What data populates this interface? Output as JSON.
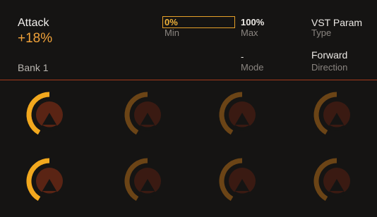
{
  "param": {
    "name": "Attack",
    "value": "+18%",
    "bank": "Bank 1"
  },
  "fields": {
    "min": {
      "value": "0%",
      "label": "Min"
    },
    "max": {
      "value": "100%",
      "label": "Max"
    },
    "mode": {
      "value": "-",
      "label": "Mode"
    },
    "type": {
      "value": "VST Param",
      "label": "Type"
    },
    "direction": {
      "value": "Forward",
      "label": "Direction"
    }
  },
  "colors": {
    "accent": "#f0a23a",
    "active_outer_arc": "#f2a81e",
    "active_inner_ring": "#f05a24",
    "active_body": "#5a2414",
    "dim_outer_arc": "#6b4416",
    "dim_inner_ring": "#5a2b18",
    "dim_body": "#3a1a12",
    "separator": "#a53a1a"
  },
  "knobs": [
    {
      "row": 1,
      "col": 1,
      "active": true
    },
    {
      "row": 1,
      "col": 2,
      "active": false
    },
    {
      "row": 1,
      "col": 3,
      "active": false
    },
    {
      "row": 1,
      "col": 4,
      "active": false
    },
    {
      "row": 2,
      "col": 1,
      "active": true
    },
    {
      "row": 2,
      "col": 2,
      "active": false
    },
    {
      "row": 2,
      "col": 3,
      "active": false
    },
    {
      "row": 2,
      "col": 4,
      "active": false
    }
  ]
}
